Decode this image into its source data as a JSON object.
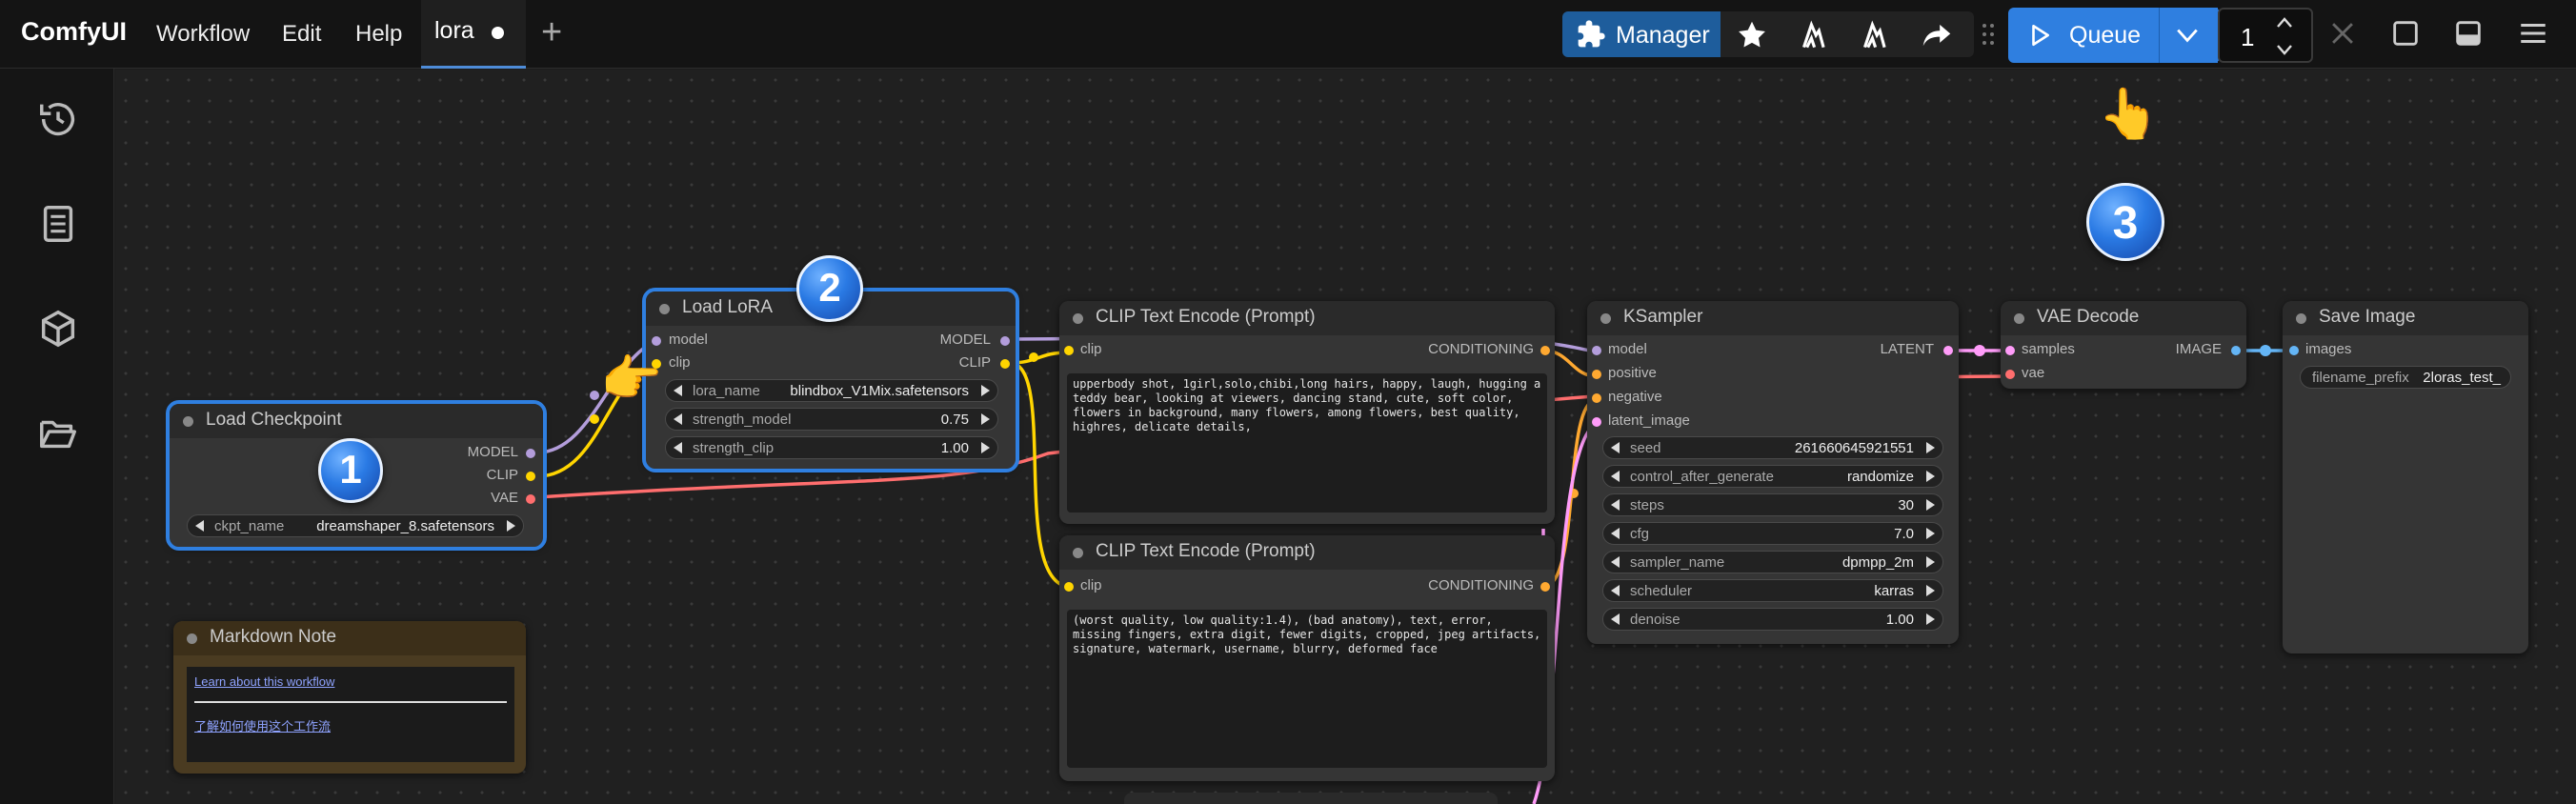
{
  "app": {
    "brand": "ComfyUI",
    "menu": [
      "Workflow",
      "Edit",
      "Help"
    ],
    "tab": {
      "label": "lora"
    }
  },
  "toolbar": {
    "manager_label": "Manager",
    "queue_label": "Queue",
    "batch_count": "1"
  },
  "nodes": {
    "load_checkpoint": {
      "title": "Load Checkpoint",
      "outputs": [
        "MODEL",
        "CLIP",
        "VAE"
      ],
      "widgets": [
        {
          "label": "ckpt_name",
          "value": "dreamshaper_8.safetensors"
        }
      ]
    },
    "load_lora": {
      "title": "Load LoRA",
      "inputs": [
        "model",
        "clip"
      ],
      "outputs": [
        "MODEL",
        "CLIP"
      ],
      "widgets": [
        {
          "label": "lora_name",
          "value": "blindbox_V1Mix.safetensors"
        },
        {
          "label": "strength_model",
          "value": "0.75"
        },
        {
          "label": "strength_clip",
          "value": "1.00"
        }
      ]
    },
    "clip_pos": {
      "title": "CLIP Text Encode (Prompt)",
      "input": "clip",
      "output": "CONDITIONING",
      "text": "upperbody shot, 1girl,solo,chibi,long hairs, happy, laugh, hugging a teddy bear, looking at viewers, dancing stand, cute, soft color, flowers in background, many flowers, among flowers, best quality, highres, delicate details,"
    },
    "clip_neg": {
      "title": "CLIP Text Encode (Prompt)",
      "input": "clip",
      "output": "CONDITIONING",
      "text": "(worst quality, low quality:1.4), (bad anatomy), text, error, missing fingers, extra digit, fewer digits, cropped, jpeg artifacts, signature, watermark, username, blurry, deformed face"
    },
    "ksampler": {
      "title": "KSampler",
      "inputs": [
        "model",
        "positive",
        "negative",
        "latent_image"
      ],
      "output": "LATENT",
      "widgets": [
        {
          "label": "seed",
          "value": "261660645921551"
        },
        {
          "label": "control_after_generate",
          "value": "randomize"
        },
        {
          "label": "steps",
          "value": "30"
        },
        {
          "label": "cfg",
          "value": "7.0"
        },
        {
          "label": "sampler_name",
          "value": "dpmpp_2m"
        },
        {
          "label": "scheduler",
          "value": "karras"
        },
        {
          "label": "denoise",
          "value": "1.00"
        }
      ]
    },
    "vae_decode": {
      "title": "VAE Decode",
      "inputs": [
        "samples",
        "vae"
      ],
      "output": "IMAGE"
    },
    "save_image": {
      "title": "Save Image",
      "input": "images",
      "widget": {
        "label": "filename_prefix",
        "value": "2loras_test_"
      }
    },
    "markdown_note": {
      "title": "Markdown Note",
      "link1": "Learn about this workflow",
      "link2": "了解如何使用这个工作流"
    }
  },
  "steps": {
    "one": "1",
    "two": "2",
    "three": "3"
  },
  "colors": {
    "accent": "#2f7fe0",
    "model_wire": "#b39ddb",
    "clip_wire": "#ffd500",
    "vae_wire": "#ff6e6e",
    "conditioning_wire": "#ffa931",
    "latent_wire": "#ff9cf9",
    "image_wire": "#64b5f6"
  },
  "icons": {
    "manager": "puzzle-icon",
    "star": "star-icon",
    "history": "history-icon",
    "library": "book-icon",
    "models": "cube-icon",
    "workflows": "folder-icon",
    "queue": "play-icon",
    "pointer": "pointing-hand-icon"
  }
}
